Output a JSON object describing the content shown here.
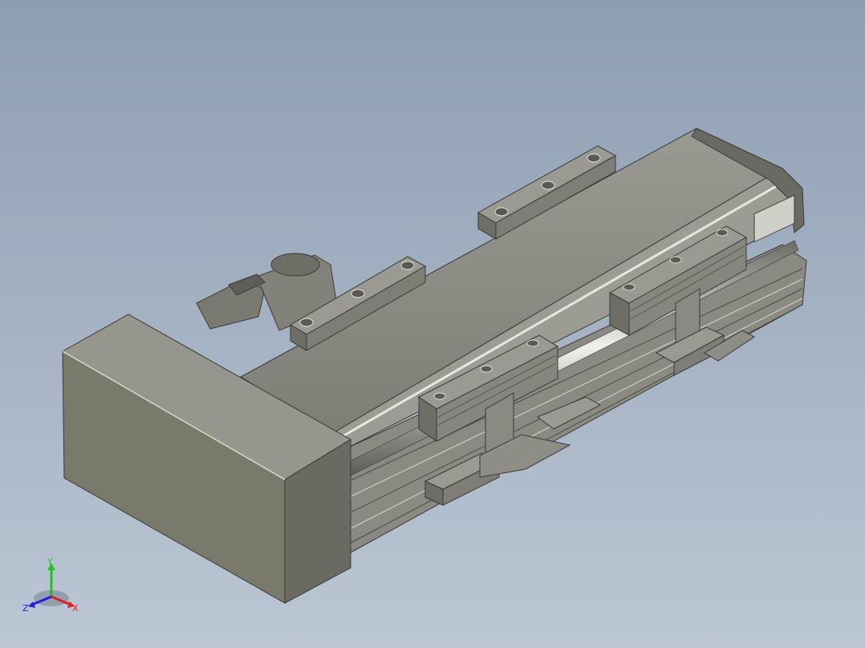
{
  "view": {
    "background_top": "#8d9db3",
    "background_bottom": "#bcc6d4",
    "model_color": "#8c8c84"
  },
  "triad": {
    "x_label": "X",
    "y_label": "Y",
    "z_label": "Z",
    "x_color": "#e02020",
    "y_color": "#20c020",
    "z_color": "#2020e0"
  }
}
